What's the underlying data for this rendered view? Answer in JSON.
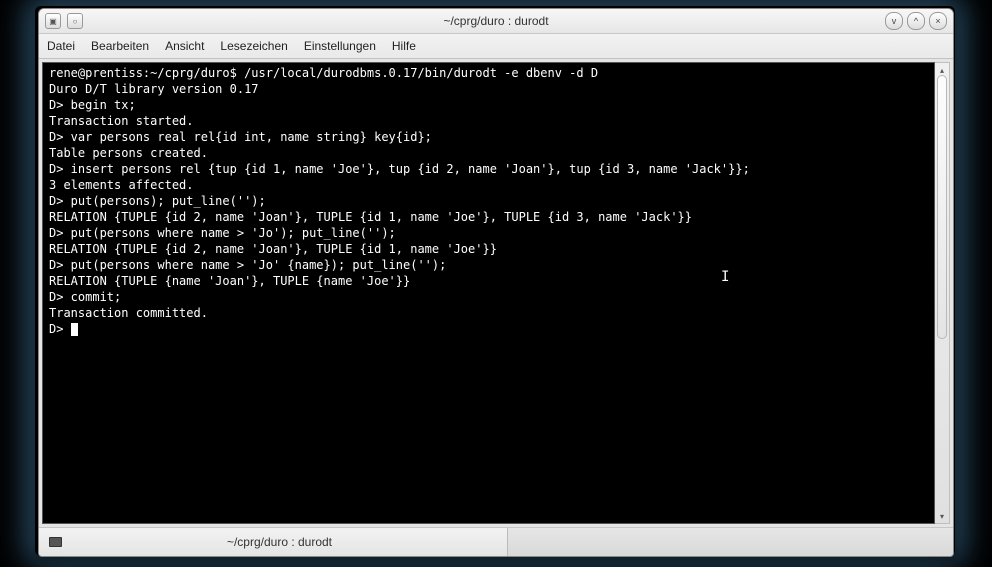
{
  "window": {
    "title": "~/cprg/duro : durodt"
  },
  "menus": {
    "file": "Datei",
    "edit": "Bearbeiten",
    "view": "Ansicht",
    "bookmarks": "Lesezeichen",
    "settings": "Einstellungen",
    "help": "Hilfe"
  },
  "tab": {
    "label": "~/cprg/duro : durodt"
  },
  "terminal": {
    "lines": [
      "rene@prentiss:~/cprg/duro$ /usr/local/durodbms.0.17/bin/durodt -e dbenv -d D",
      "Duro D/T library version 0.17",
      "D> begin tx;",
      "Transaction started.",
      "D> var persons real rel{id int, name string} key{id};",
      "Table persons created.",
      "D> insert persons rel {tup {id 1, name 'Joe'}, tup {id 2, name 'Joan'}, tup {id 3, name 'Jack'}};",
      "3 elements affected.",
      "D> put(persons); put_line('');",
      "RELATION {TUPLE {id 2, name 'Joan'}, TUPLE {id 1, name 'Joe'}, TUPLE {id 3, name 'Jack'}}",
      "D> put(persons where name > 'Jo'); put_line('');",
      "RELATION {TUPLE {id 2, name 'Joan'}, TUPLE {id 1, name 'Joe'}}",
      "D> put(persons where name > 'Jo' {name}); put_line('');",
      "RELATION {TUPLE {name 'Joan'}, TUPLE {name 'Joe'}}",
      "D> commit;",
      "Transaction committed.",
      "D> "
    ]
  },
  "icons": {
    "minimize": "v",
    "maximize": "^",
    "close": "×",
    "up": "▴",
    "down": "▾"
  }
}
